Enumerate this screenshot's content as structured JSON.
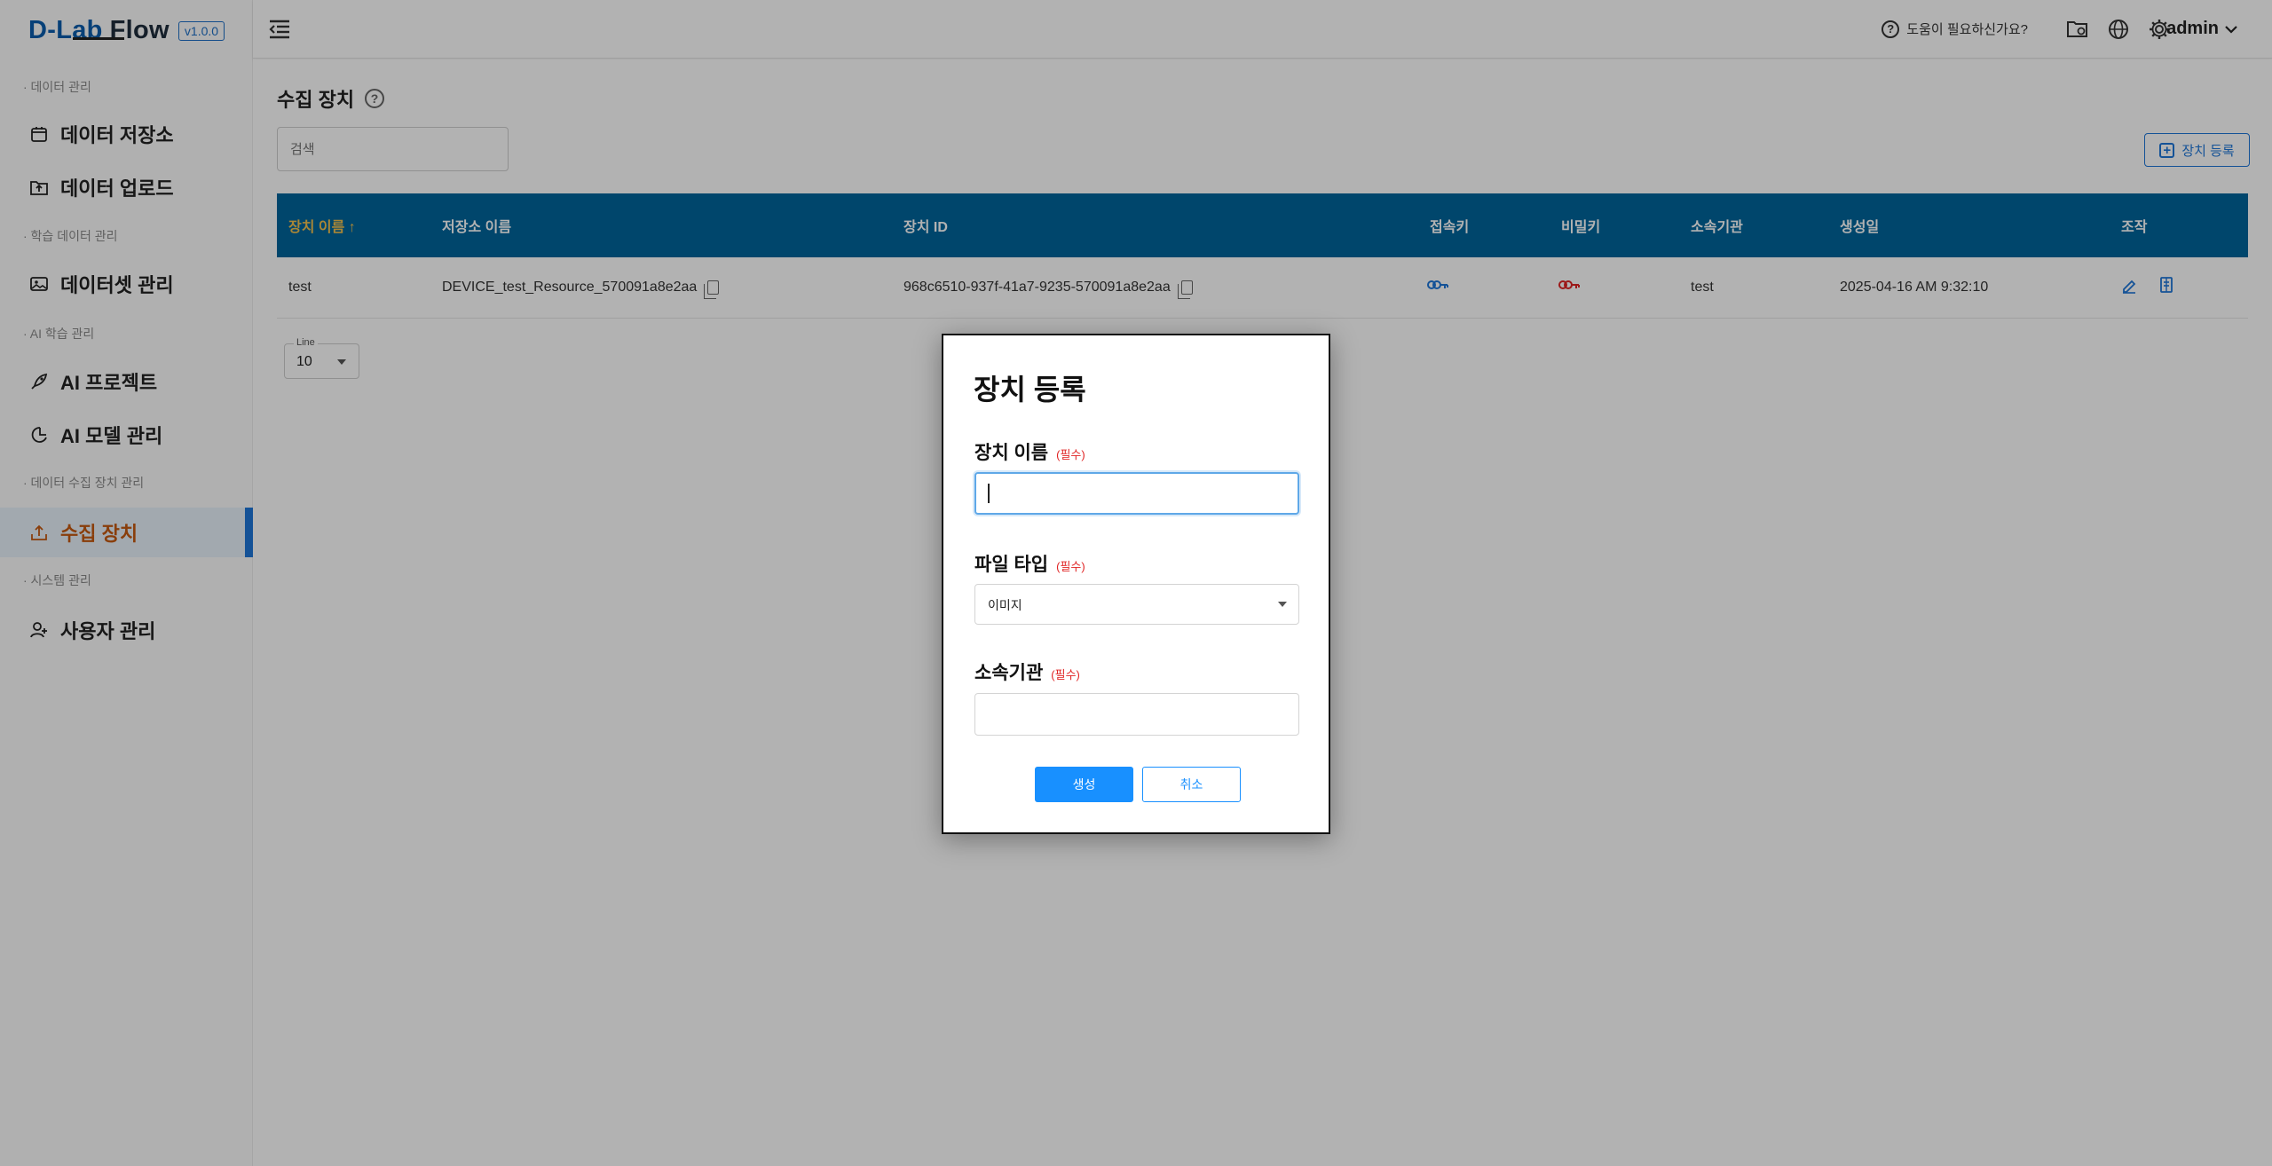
{
  "brand": {
    "name": "D-Lab",
    "name2": "Flow",
    "version": "v1.0.0"
  },
  "sidebar": {
    "sections": [
      "· 데이터 관리",
      "· 학습 데이터 관리",
      "· AI 학습 관리",
      "· 데이터 수집 장치 관리",
      "· 시스템 관리"
    ],
    "items": [
      {
        "label": "데이터 저장소",
        "icon": "archive-icon"
      },
      {
        "label": "데이터 업로드",
        "icon": "folder-upload-icon"
      },
      {
        "label": "데이터셋 관리",
        "icon": "images-icon"
      },
      {
        "label": "AI 프로젝트",
        "icon": "rocket-icon"
      },
      {
        "label": "AI 모델 관리",
        "icon": "model-icon"
      },
      {
        "label": "수집 장치",
        "icon": "upload-tray-icon",
        "active": true
      },
      {
        "label": "사용자 관리",
        "icon": "user-plus-icon"
      }
    ]
  },
  "topbar": {
    "help": "도움이 필요하신가요?",
    "user": "admin"
  },
  "page": {
    "title": "수집 장치",
    "search_placeholder": "검색",
    "register_label": "장치 등록"
  },
  "table": {
    "columns": [
      "장치 이름 ↑",
      "저장소 이름",
      "장치 ID",
      "접속키",
      "비밀키",
      "소속기관",
      "생성일",
      "조작"
    ],
    "rows": [
      {
        "name": "test",
        "storage": "DEVICE_test_Resource_570091a8e2aa",
        "device_id": "968c6510-937f-41a7-9235-570091a8e2aa",
        "org": "test",
        "created": "2025-04-16 AM 9:32:10"
      }
    ]
  },
  "pager": {
    "label": "Line",
    "value": "10"
  },
  "modal": {
    "title": "장치 등록",
    "required": "(필수)",
    "device_name_label": "장치 이름",
    "device_name_value": "",
    "file_type_label": "파일 타입",
    "file_type_value": "이미지",
    "org_label": "소속기관",
    "org_value": "",
    "create_label": "생성",
    "cancel_label": "취소"
  },
  "colors": {
    "primary": "#1890ff",
    "table_header": "#00659b",
    "sorted_header": "#f2c14e",
    "active_nav": "#c55a11",
    "required": "#e02424",
    "access_key": "#1e76d8",
    "secret_key": "#e02424"
  }
}
